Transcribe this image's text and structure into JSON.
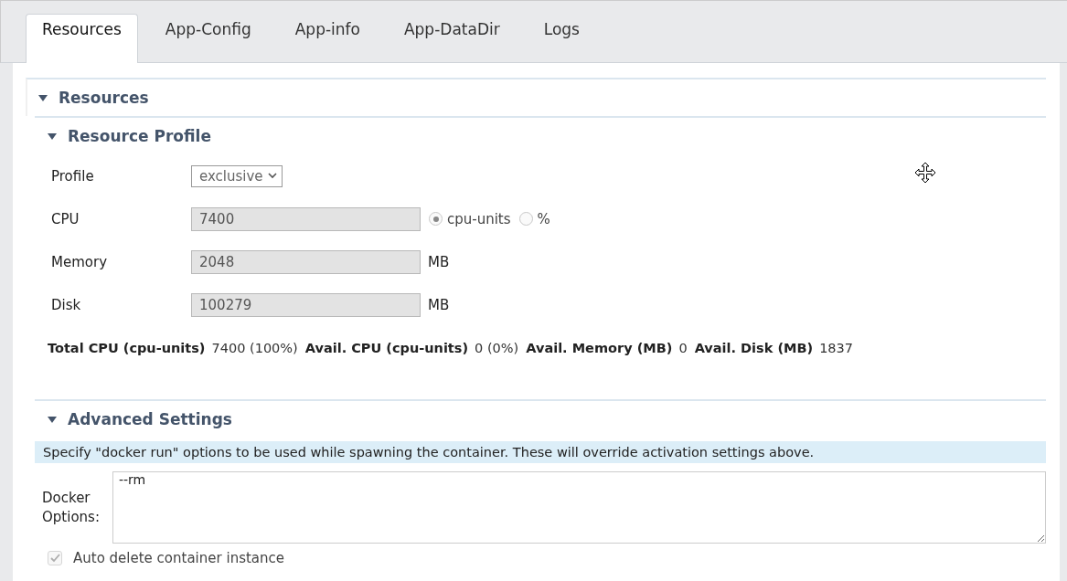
{
  "tabs": [
    {
      "label": "Resources",
      "selected": true
    },
    {
      "label": "App-Config",
      "selected": false
    },
    {
      "label": "App-info",
      "selected": false
    },
    {
      "label": "App-DataDir",
      "selected": false
    },
    {
      "label": "Logs",
      "selected": false
    }
  ],
  "section": {
    "title": "Resources",
    "expanded": true
  },
  "profile": {
    "title": "Resource Profile",
    "expanded": true,
    "rows": [
      {
        "kind": "select",
        "label": "Profile",
        "value": "exclusive"
      },
      {
        "kind": "radio",
        "label": "CPU",
        "value": "7400",
        "disabled": true,
        "options": [
          {
            "label": "cpu-units",
            "selected": true
          },
          {
            "label": "%",
            "selected": false
          }
        ]
      },
      {
        "kind": "unit",
        "label": "Memory",
        "value": "2048",
        "disabled": true,
        "unit": "MB"
      },
      {
        "kind": "unit",
        "label": "Disk",
        "value": "100279",
        "disabled": true,
        "unit": "MB"
      }
    ],
    "stats": [
      {
        "label": "Total CPU (cpu-units)",
        "value": "7400 (100%)"
      },
      {
        "label": "Avail. CPU (cpu-units)",
        "value": "0 (0%)"
      },
      {
        "label": "Avail. Memory (MB)",
        "value": "0"
      },
      {
        "label": "Avail. Disk (MB)",
        "value": "1837"
      }
    ]
  },
  "advanced": {
    "title": "Advanced Settings",
    "expanded": true,
    "note": "Specify \"docker run\" options to be used while spawning the container. These will override activation settings above.",
    "docker_label": "Docker Options:",
    "docker_value": "--rm",
    "auto_delete": {
      "label": "Auto delete container instance",
      "checked": true,
      "disabled": true
    }
  }
}
